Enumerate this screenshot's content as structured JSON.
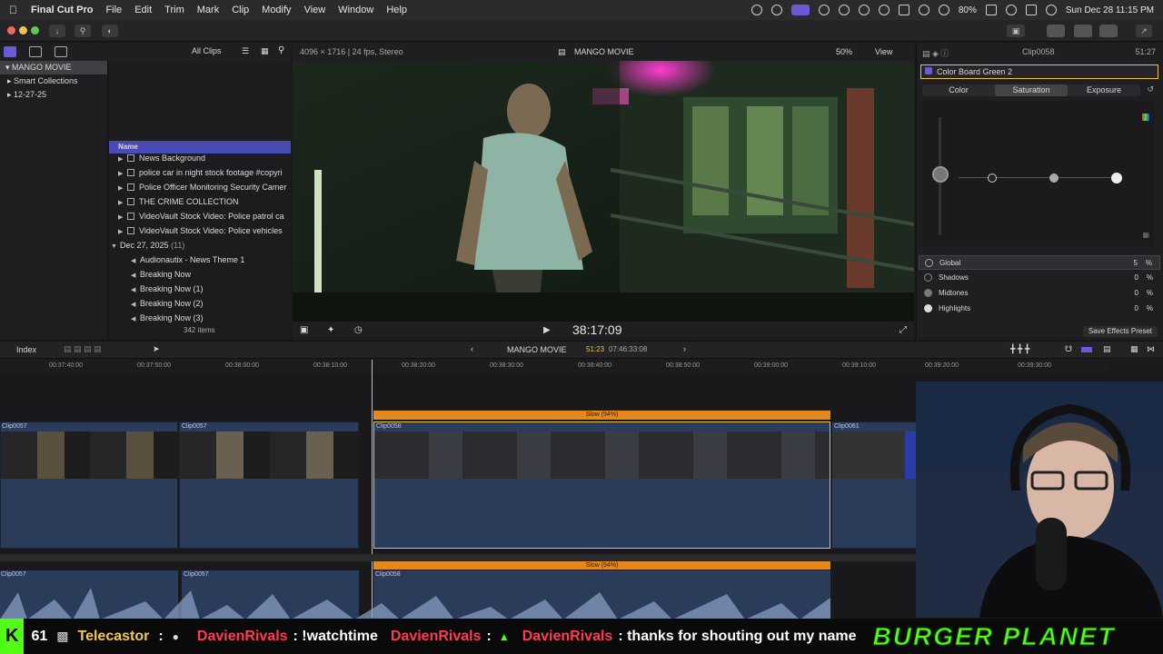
{
  "menubar": {
    "items": [
      "Final Cut Pro",
      "File",
      "Edit",
      "Trim",
      "Mark",
      "Clip",
      "Modify",
      "View",
      "Window",
      "Help"
    ],
    "battery": "80%",
    "datetime": "Sun Dec 28  11:15 PM"
  },
  "library": {
    "filter": "All Clips",
    "sidebar": [
      "MANGO MOVIE",
      "Smart Collections",
      "12-27-25"
    ],
    "column_header": "Name",
    "rows": [
      "News Background",
      "police  car in night stock footage #copyri",
      "Police Officer Monitoring Security Camer",
      "THE CRIME COLLECTION",
      "VideoVault Stock Video:  Police patrol ca",
      "VideoVault Stock Video:  Police vehicles"
    ],
    "date_group": "Dec 27, 2025",
    "date_group_count": "(11)",
    "audio_rows": [
      "Audionautix - News Theme 1",
      "Breaking Now",
      "Breaking Now (1)",
      "Breaking Now (2)",
      "Breaking Now (3)"
    ],
    "item_count": "342 items"
  },
  "viewer": {
    "format": "4096 × 1716 | 24 fps, Stereo",
    "project": "MANGO MOVIE",
    "zoom": "50%",
    "view_label": "View",
    "timecode": "38:17:09"
  },
  "inspector": {
    "clip_name": "Clip0058",
    "clip_duration": "51:27",
    "effect": "Color Board Green 2",
    "tabs": [
      "Color",
      "Saturation",
      "Exposure"
    ],
    "active_tab": "Saturation",
    "params": [
      {
        "label": "Global",
        "value": "5",
        "unit": "%"
      },
      {
        "label": "Shadows",
        "value": "0",
        "unit": "%"
      },
      {
        "label": "Midtones",
        "value": "0",
        "unit": "%"
      },
      {
        "label": "Highlights",
        "value": "0",
        "unit": "%"
      }
    ],
    "save_preset": "Save Effects Preset"
  },
  "timeline": {
    "index_label": "Index",
    "project": "MANGO MOVIE",
    "position": "51:23",
    "duration": "07:46:33:08",
    "ruler": [
      "00:37:40:00",
      "00:37:50:00",
      "00:38:00:00",
      "00:38:10:00",
      "00:38:20:00",
      "00:38:30:00",
      "00:38:40:00",
      "00:38:50:00",
      "00:39:00:00",
      "00:39:10:00",
      "00:39:20:00",
      "00:39:30:00"
    ],
    "clips": [
      "Clip0057",
      "Clip0057",
      "Clip0058",
      "Clip0061"
    ],
    "retime_label": "Slow (94%)"
  },
  "ticker": {
    "kick_count": "61",
    "user1": "Telecastor",
    "user2": "DavienRivals",
    "msg2": ": !watchtime",
    "user3": "DavienRivals",
    "user4": "DavienRivals",
    "msg4": ": thanks for shouting out my name",
    "brand": "BURGER  PLANET"
  },
  "colors": {
    "accent": "#6b5ad6",
    "retime_orange": "#e3891f",
    "selection_yellow": "#e8c54a",
    "clip_blue": "#2b3b5a",
    "kick_green": "#53fc18",
    "chat_red": "#ff3a55"
  }
}
